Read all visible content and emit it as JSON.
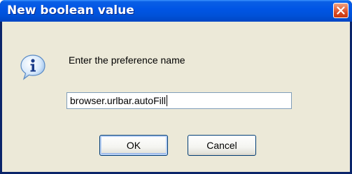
{
  "window": {
    "title": "New boolean value",
    "close_icon": "close-icon"
  },
  "dialog": {
    "icon": "info-icon",
    "prompt": "Enter the preference name",
    "input_value": "browser.urlbar.autoFill",
    "ok_label": "OK",
    "cancel_label": "Cancel"
  },
  "colors": {
    "titlebar": "#0055e5",
    "client_bg": "#ece9d8",
    "close_button": "#d6461f",
    "input_border": "#7f9db9"
  }
}
